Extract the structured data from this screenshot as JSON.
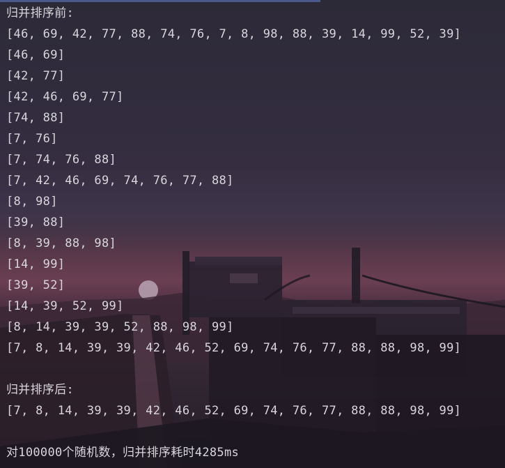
{
  "console": {
    "before_header": "归并排序前:",
    "lines": [
      "[46, 69, 42, 77, 88, 74, 76, 7, 8, 98, 88, 39, 14, 99, 52, 39]",
      "[46, 69]",
      "[42, 77]",
      "[42, 46, 69, 77]",
      "[74, 88]",
      "[7, 76]",
      "[7, 74, 76, 88]",
      "[7, 42, 46, 69, 74, 76, 77, 88]",
      "[8, 98]",
      "[39, 88]",
      "[8, 39, 88, 98]",
      "[14, 99]",
      "[39, 52]",
      "[14, 39, 52, 99]",
      "[8, 14, 39, 39, 52, 88, 98, 99]",
      "[7, 8, 14, 39, 39, 42, 46, 52, 69, 74, 76, 77, 88, 88, 98, 99]"
    ],
    "after_header": "归并排序后:",
    "sorted_line": "[7, 8, 14, 39, 39, 42, 46, 52, 69, 74, 76, 77, 88, 88, 98, 99]",
    "timing_line": "对100000个随机数，归并排序耗时4285ms"
  }
}
